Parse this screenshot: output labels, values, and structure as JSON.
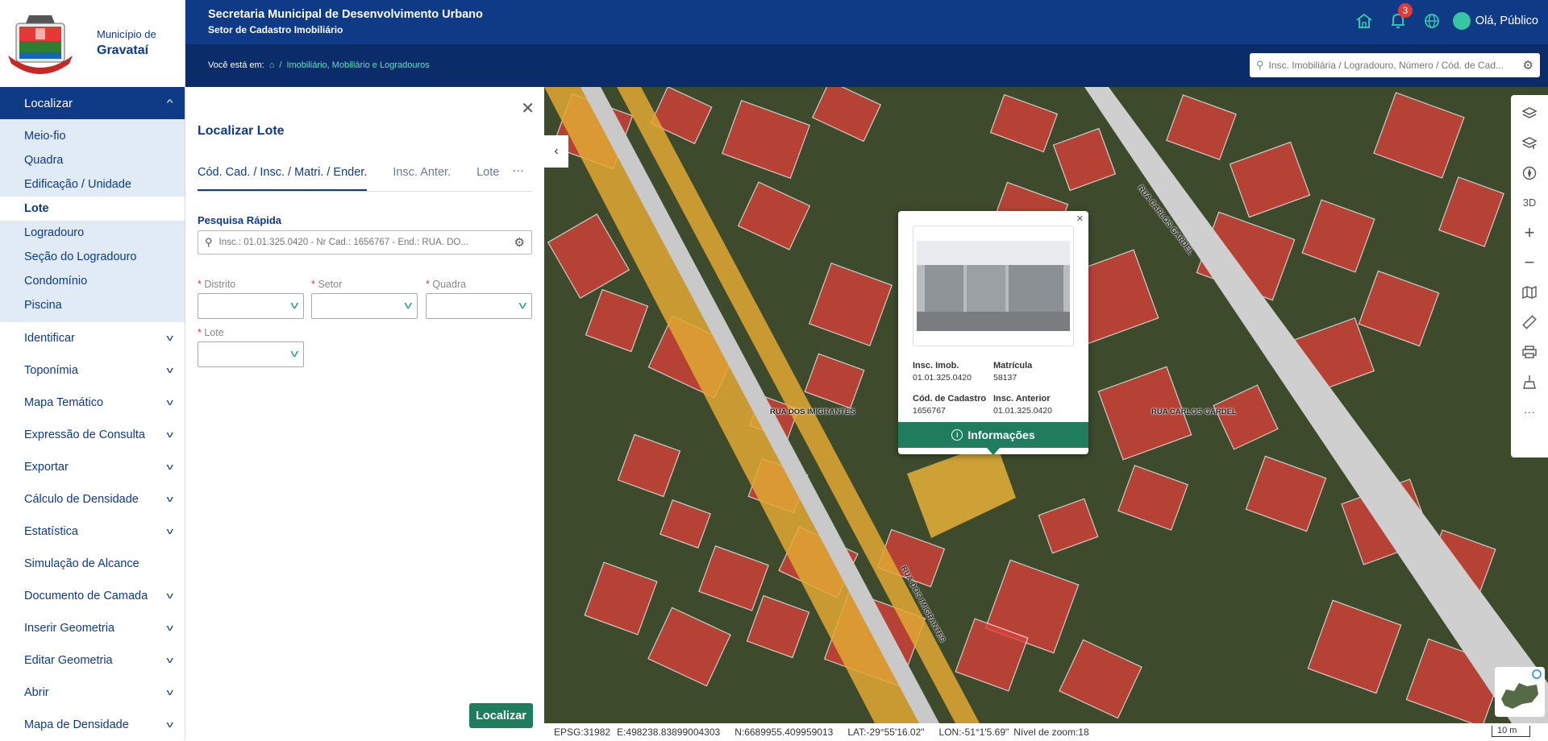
{
  "municipality": {
    "small": "Município de",
    "big": "Gravataí"
  },
  "header": {
    "title": "Secretaria Municipal de Desenvolvimento Urbano",
    "subtitle": "Setor de Cadastro Imobiliário",
    "notifications": "3",
    "user": "Olá, Público"
  },
  "breadcrumb": {
    "label": "Você está em:",
    "sep": "/",
    "current": "Imobiliário, Mobiliário e Logradouros"
  },
  "search_top": {
    "placeholder": "Insc. Imobiliária / Logradouro, Número / Cód. de Cad..."
  },
  "sidebar": {
    "open_menu": "Localizar",
    "sub_items": [
      "Meio-fio",
      "Quadra",
      "Edificação / Unidade",
      "Lote",
      "Logradouro",
      "Seção do Logradouro",
      "Condomínio",
      "Piscina"
    ],
    "active_sub": "Lote",
    "menu_items": [
      {
        "label": "Identificar",
        "chevron": true
      },
      {
        "label": "Toponímia",
        "chevron": true
      },
      {
        "label": "Mapa Temático",
        "chevron": true
      },
      {
        "label": "Expressão de Consulta",
        "chevron": true
      },
      {
        "label": "Exportar",
        "chevron": true
      },
      {
        "label": "Cálculo de Densidade",
        "chevron": true
      },
      {
        "label": "Estatística",
        "chevron": true
      },
      {
        "label": "Simulação de Alcance",
        "chevron": false
      },
      {
        "label": "Documento de Camada",
        "chevron": true
      },
      {
        "label": "Inserir Geometria",
        "chevron": true
      },
      {
        "label": "Editar Geometria",
        "chevron": true
      },
      {
        "label": "Abrir",
        "chevron": true
      },
      {
        "label": "Mapa de Densidade",
        "chevron": true
      }
    ]
  },
  "panel": {
    "title": "Localizar Lote",
    "tabs": [
      "Cód. Cad. / Insc. / Matri. / Ender.",
      "Insc. Anter.",
      "Lote"
    ],
    "quick_search_label": "Pesquisa Rápida",
    "quick_search_placeholder": "Insc.: 01.01.325.0420 - Nr Cad.: 1656767 - End.: RUA. DO...",
    "fields": {
      "distrito": "Distrito",
      "setor": "Setor",
      "quadra": "Quadra",
      "lote": "Lote",
      "required_mark": "*"
    },
    "button": "Localizar"
  },
  "popup": {
    "insc_imob_label": "Insc. Imob.",
    "insc_imob": "01.01.325.0420",
    "matricula_label": "Matrícula",
    "matricula": "58137",
    "cod_cadastro_label": "Cód. de Cadastro",
    "cod_cadastro": "1656767",
    "insc_anterior_label": "Insc. Anterior",
    "insc_anterior": "01.01.325.0420",
    "button": "Informações"
  },
  "map": {
    "streets": [
      "RUA DOS IMIGRANTES",
      "RUA CARLOS GARDEL"
    ],
    "toolbar": [
      "layers-icon",
      "layers-add-icon",
      "compass-icon",
      "3D",
      "zoom-in-icon",
      "zoom-out-icon",
      "map-icon",
      "ruler-icon",
      "print-icon",
      "broom-icon",
      "more-icon"
    ]
  },
  "status": {
    "epsg": "EPSG:31982",
    "e": "E:498238.83899004303",
    "n": "N:6689955.409959013",
    "lat": "LAT:-29°55'16.02\"",
    "lon": "LON:-51°1'5.69\"",
    "zoom": "Nível de zoom:18",
    "scale": "10 m"
  },
  "colors": {
    "primary": "#0f3a86",
    "accent": "#36c6a4",
    "button": "#1f7d5d"
  }
}
